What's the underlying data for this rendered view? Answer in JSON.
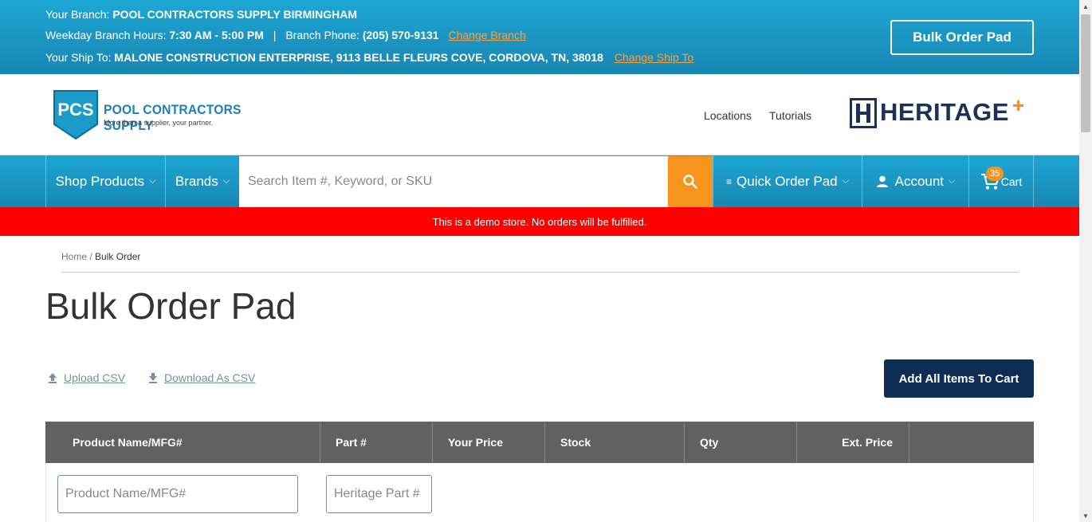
{
  "topbar": {
    "branch_label": "Your Branch:",
    "branch_name": "POOL CONTRACTORS SUPPLY BIRMINGHAM",
    "hours_label": "Weekday Branch Hours:",
    "hours_value": "7:30 AM - 5:00 PM",
    "separator": "|",
    "phone_label": "Branch Phone:",
    "phone_value": "(205) 570-9131",
    "change_branch": "Change Branch",
    "ship_label": "Your Ship To:",
    "ship_value": "MALONE CONSTRUCTION ENTERPRISE, 9113 BELLE FLEURS COVE, CORDOVA, TN, 38018",
    "change_ship": "Change Ship To",
    "bulk_order_button": "Bulk Order Pad"
  },
  "header": {
    "logo_letters": "PCS",
    "logo_name": "POOL CONTRACTORS SUPPLY",
    "logo_tagline": "More than a supplier, your partner.",
    "links": [
      "Locations",
      "Tutorials"
    ],
    "partner_logo": "HERITAGE"
  },
  "navbar": {
    "shop_products": "Shop Products",
    "brands": "Brands",
    "search_placeholder": "Search Item #, Keyword, or SKU",
    "quick_order": "Quick Order Pad",
    "account": "Account",
    "cart": "Cart",
    "cart_count": "35"
  },
  "demo_banner": "This is a demo store. No orders will be fulfilled.",
  "breadcrumb": {
    "home": "Home",
    "separator": "/",
    "current": "Bulk Order"
  },
  "page_title": "Bulk Order Pad",
  "actions": {
    "upload_csv": "Upload CSV",
    "download_csv": "Download As CSV",
    "add_all": "Add All Items To Cart"
  },
  "table": {
    "headers": [
      "Product Name/MFG#",
      "Part #",
      "Your Price",
      "Stock",
      "Qty",
      "Ext. Price"
    ],
    "product_placeholder": "Product Name/MFG#",
    "part_placeholder": "Heritage Part #"
  },
  "colors": {
    "brand_blue": "#1a9bc9",
    "accent_orange": "#f7941d",
    "navy": "#0d2d55",
    "demo_red": "#ff0000",
    "table_header": "#616161"
  }
}
